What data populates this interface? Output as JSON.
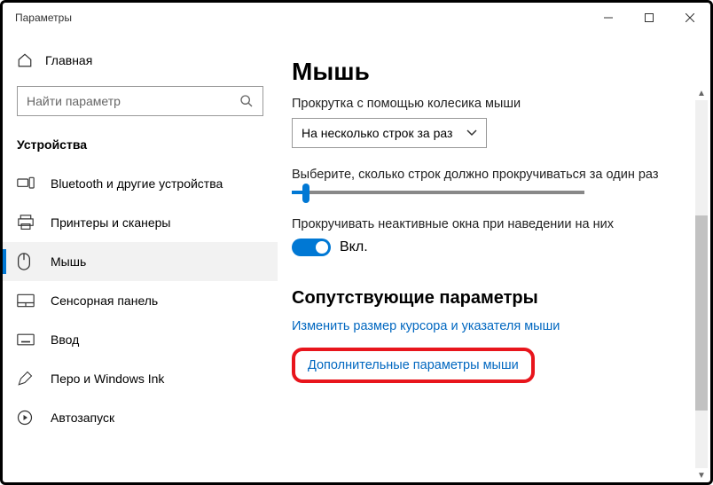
{
  "window": {
    "title": "Параметры"
  },
  "sidebar": {
    "home": "Главная",
    "search_placeholder": "Найти параметр",
    "section": "Устройства",
    "items": [
      {
        "label": "Bluetooth и другие устройства"
      },
      {
        "label": "Принтеры и сканеры"
      },
      {
        "label": "Мышь"
      },
      {
        "label": "Сенсорная панель"
      },
      {
        "label": "Ввод"
      },
      {
        "label": "Перо и Windows Ink"
      },
      {
        "label": "Автозапуск"
      }
    ]
  },
  "main": {
    "title": "Мышь",
    "scroll_label": "Прокрутка с помощью колесика мыши",
    "scroll_value": "На несколько строк за раз",
    "lines_label": "Выберите, сколько строк должно прокручиваться за один раз",
    "inactive_label": "Прокручивать неактивные окна при наведении на них",
    "toggle_state": "Вкл.",
    "related_title": "Сопутствующие параметры",
    "link_cursor": "Изменить размер курсора и указателя мыши",
    "link_additional": "Дополнительные параметры мыши"
  }
}
